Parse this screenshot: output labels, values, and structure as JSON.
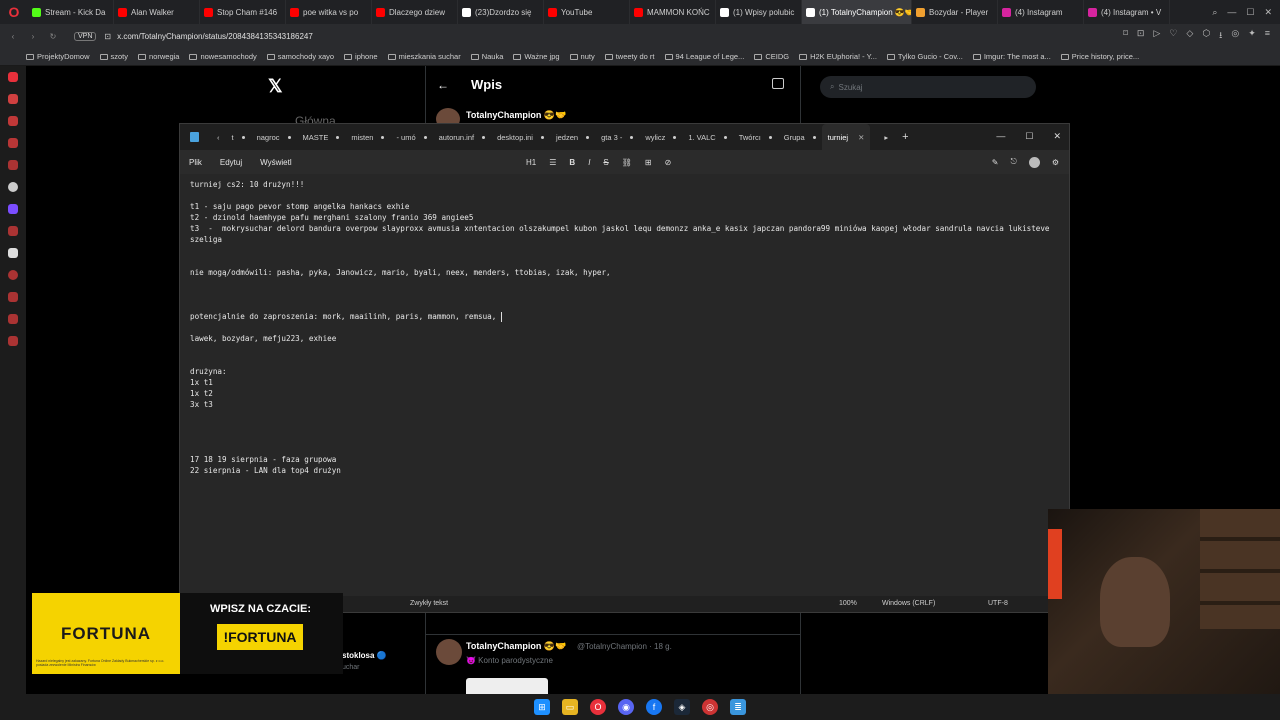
{
  "browser": {
    "tabs": [
      {
        "label": "Stream - Kick Da",
        "color": "#53fc18"
      },
      {
        "label": "Alan Walker",
        "color": "#ff0000"
      },
      {
        "label": "Stop Cham #146",
        "color": "#ff0000"
      },
      {
        "label": "poe witka vs po",
        "color": "#ff0000"
      },
      {
        "label": "Dlaczego dziew",
        "color": "#ff0000"
      },
      {
        "label": "(23)Dzordzo się",
        "color": "#ffffff"
      },
      {
        "label": "YouTube",
        "color": "#ff0000"
      },
      {
        "label": "MAMMON KOŃC",
        "color": "#ff0000"
      },
      {
        "label": "(1) Wpisy polubic",
        "color": "#ffffff"
      },
      {
        "label": "(1) TotalnyChampion 😎🤝",
        "color": "#ffffff",
        "active": true
      },
      {
        "label": "Bozydar - Player",
        "color": "#f0a030"
      },
      {
        "label": "(4) Instagram",
        "color": "#d6249f"
      },
      {
        "label": "(4) Instagram • V",
        "color": "#d6249f"
      }
    ],
    "vpn_label": "VPN",
    "url": "x.com/TotalnyChampion/status/2084384135343186247",
    "bookmarks": [
      "ProjektyDomow",
      "szoty",
      "norwegia",
      "nowesamochody",
      "samochody xayo",
      "iphone",
      "mieszkania suchar",
      "Nauka",
      "Ważne jpg",
      "nuty",
      "tweety do rt",
      "94 League of Lege...",
      "CEIDG",
      "H2K EUphoria! - Y...",
      "Tylko Gucio - Cov...",
      "Imgur: The most a...",
      "Price history, price..."
    ]
  },
  "x": {
    "logo": "𝕏",
    "left_cut_text": "Główna",
    "back_arrow": "←",
    "title": "Wpis",
    "search_placeholder": "Szukaj",
    "post_author": "TotalnyChampion 😎🤝",
    "post2_author": "TotalnyChampion 😎🤝",
    "post2_handle": "@TotalnyChampion · 18 g.",
    "post2_sub": "😈 Konto parodystyczne",
    "stoklosa_name": "stoklosa 🔵",
    "stoklosa_sub": "uchar"
  },
  "notepad": {
    "tabs": [
      "‹",
      "t",
      "nagroc",
      "MASTE",
      "misten",
      "- umó",
      "autorun.inf",
      "desktop.ini",
      "jedzen",
      "gta 3 -",
      "wylicz",
      "1. VALC",
      "Twórcı",
      "Grupa",
      "turniej"
    ],
    "active_close": "✕",
    "add_tab": "+",
    "menu": {
      "file": "Plik",
      "edit": "Edytuj",
      "view": "Wyświetl"
    },
    "format": {
      "heading": "H1",
      "list": "☰",
      "bold": "B",
      "italic": "I",
      "strike": "S",
      "link": "🔗",
      "table": "⊞"
    },
    "lines": [
      "turniej cs2: 10 drużyn!!!",
      "",
      "t1 - saju pago pevor stomp angelka hankacs exhie",
      "t2 - dzinold haemhype pafu merghani szalony franio 369 angiee5",
      "t3  -  mokrysuchar delord bandura overpow slayproxx avmusia xntentacion olszakumpel kubon jaskol lequ demonzz anka_e kasix japczan pandora99 miniówa kaopej włodar sandrula navcia lukisteve szeliga",
      "",
      "",
      "nie mogą/odmówili: pasha, pyka, Janowicz, mario, byali, neex, menders, ttobias, izak, hyper,",
      "",
      "",
      "",
      "potencjalnie do zaproszenia: mork, maailinh, paris, mammon, remsua, ",
      "",
      "lawek, bozydar, mefju223, exhiee",
      "",
      "",
      "drużyna:",
      "1x t1",
      "1x t2",
      "3x t3",
      "",
      "",
      "",
      "",
      "17 18 19 sierpnia - faza grupowa",
      "22 sierpnia - LAN dla top4 drużyn"
    ],
    "status": {
      "format": "Zwykły tekst",
      "zoom": "100%",
      "eol": "Windows (CRLF)",
      "encoding": "UTF-8"
    }
  },
  "fortuna": {
    "logo": "FORTUNA",
    "cta": "WPISZ NA CZACIE:",
    "command": "!FORTUNA",
    "fine_print": "Hazard nielegalny jest zakazany. Fortuna Online Zakłady Bukmacherskie sp. z o.o. posiada zezwolenie Ministra Finansów"
  }
}
